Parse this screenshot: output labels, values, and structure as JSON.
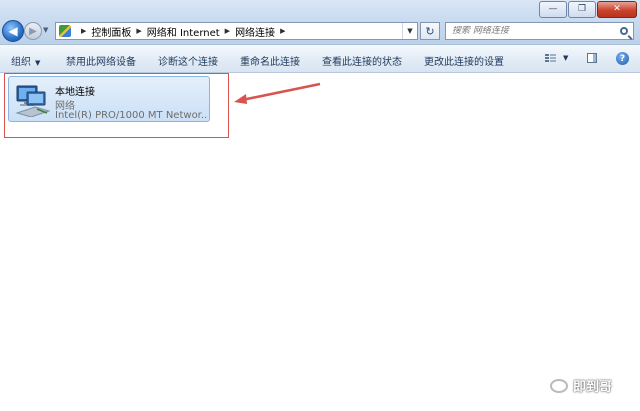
{
  "window": {
    "minimize_glyph": "—",
    "maximize_glyph": "❐",
    "close_glyph": "✕"
  },
  "address_bar": {
    "breadcrumbs": [
      "控制面板",
      "网络和 Internet",
      "网络连接"
    ]
  },
  "search": {
    "placeholder": "搜索 网络连接"
  },
  "toolbar": {
    "organize_label": "组织",
    "disable_label": "禁用此网络设备",
    "diagnose_label": "诊断这个连接",
    "rename_label": "重命名此连接",
    "view_status_label": "查看此连接的状态",
    "change_settings_label": "更改此连接的设置",
    "help_glyph": "?"
  },
  "connection": {
    "name": "本地连接",
    "network": "网络",
    "adapter": "Intel(R) PRO/1000 MT Networ..."
  },
  "watermark": {
    "text": "即到哥"
  },
  "colors": {
    "annotation": "#d9534f",
    "card_border": "#8bb4e2"
  }
}
